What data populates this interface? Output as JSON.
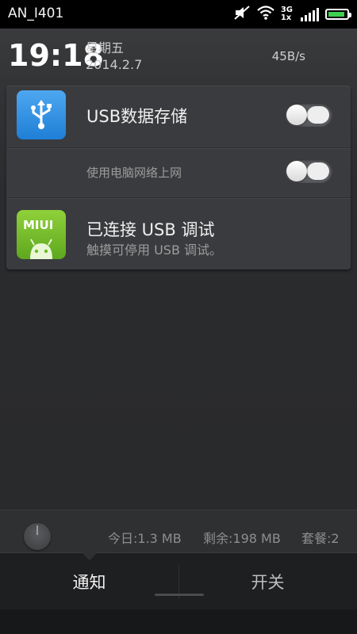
{
  "status_bar": {
    "carrier": "AN_I401",
    "network_top": "3G",
    "network_bottom": "1x",
    "battery_level": 0.9,
    "icons": [
      "muted-icon",
      "wifi-icon",
      "signal-icon",
      "battery-icon"
    ],
    "battery_color": "#3ed04f"
  },
  "header": {
    "time": "19:18",
    "weekday": "星期五",
    "date": "2014.2.7",
    "speed": "45B/s"
  },
  "notifications": {
    "usb_storage": {
      "title": "USB数据存储",
      "toggle_on": false,
      "icon": "usb-icon",
      "icon_color": "#2f8fe3"
    },
    "tethering": {
      "title": "使用电脑网络上网",
      "toggle_on": false
    },
    "usb_debug": {
      "title": "已连接 USB 调试",
      "subtitle": "触摸可停用 USB 调试。",
      "icon_text": "MIUI",
      "icon": "android-icon",
      "icon_color": "#6fbb27"
    }
  },
  "traffic": {
    "today": "今日:1.3 MB",
    "remaining": "剩余:198 MB",
    "plan": "套餐:2"
  },
  "tabs": {
    "notify": "通知",
    "switches": "开关"
  }
}
